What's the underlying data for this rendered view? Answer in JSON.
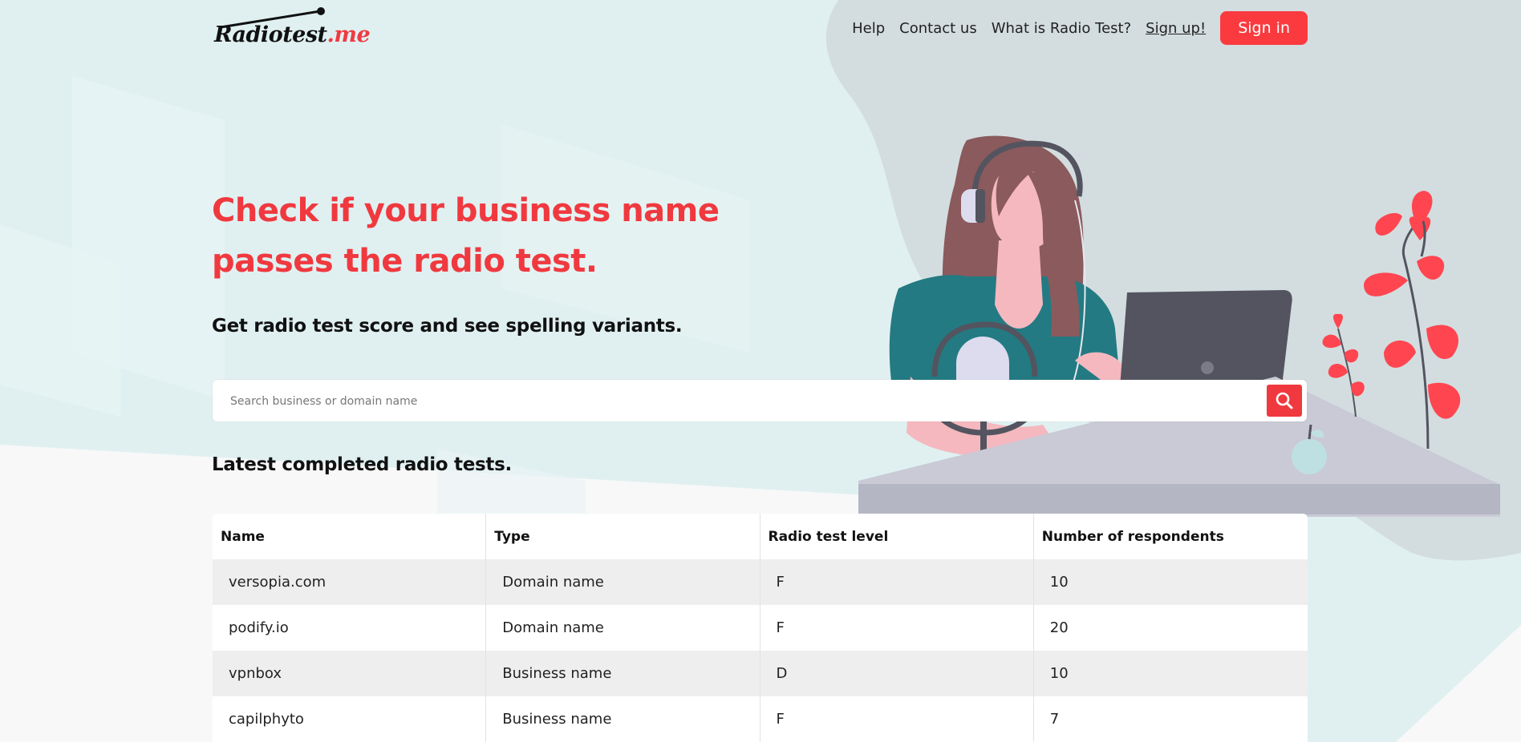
{
  "logo": {
    "text_main": "Radiotest",
    "text_suffix": ".me"
  },
  "nav": {
    "items": [
      {
        "label": "Help"
      },
      {
        "label": "Contact us"
      },
      {
        "label": "What is Radio Test?"
      },
      {
        "label": "Sign up!"
      }
    ],
    "signin_label": "Sign in"
  },
  "hero": {
    "title_line1": "Check if your business name",
    "title_line2": "passes the radio test.",
    "subtitle": "Get radio test score and see spelling variants."
  },
  "search": {
    "placeholder": "Search business or domain name",
    "button_icon": "search-icon"
  },
  "latest": {
    "title": "Latest completed radio tests.",
    "columns": [
      "Name",
      "Type",
      "Radio test level",
      "Number of respondents"
    ],
    "rows": [
      [
        "versopia.com",
        "Domain name",
        "F",
        "10"
      ],
      [
        "podify.io",
        "Domain name",
        "F",
        "20"
      ],
      [
        "vpnbox",
        "Business name",
        "D",
        "10"
      ],
      [
        "capilphyto",
        "Business name",
        "F",
        "7"
      ]
    ]
  },
  "colors": {
    "accent": "#f0393f",
    "background_teal": "#e0f0f1",
    "background_blob": "#d2dcdd",
    "table_row_alt": "#eeeeee"
  },
  "illustration": {
    "icon": "woman-podcast-illustration"
  }
}
